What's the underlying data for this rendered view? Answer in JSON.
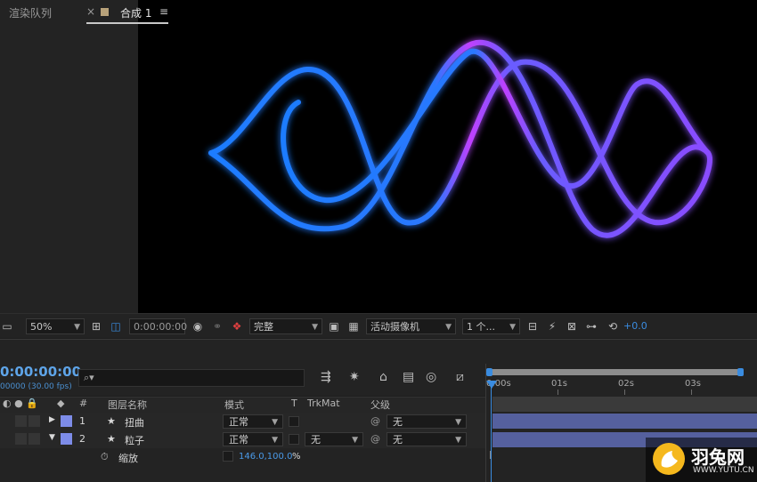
{
  "viewer_toolbar": {
    "zoom": "50%",
    "timecode": "0:00:00:00",
    "resolution": "完整",
    "camera": "活动摄像机",
    "views": "1 个...",
    "exposure": "+0.0"
  },
  "tabs": {
    "render_queue": "渲染队列",
    "close": "×",
    "comp": "合成 1",
    "menu": "≡"
  },
  "timeline": {
    "timecode": "0:00:00:00",
    "fps": "00000 (30.00 fps)",
    "search_placeholder": "",
    "ruler": [
      "0:00s",
      "01s",
      "02s",
      "03s"
    ]
  },
  "layer_header": {
    "num": "#",
    "name": "图层名称",
    "mode": "模式",
    "t": "T",
    "trkmat": "TrkMat",
    "parent": "父级"
  },
  "layers": [
    {
      "num": "1",
      "name": "扭曲",
      "mode": "正常",
      "trkmat": "",
      "parent": "无"
    },
    {
      "num": "2",
      "name": "粒子",
      "mode": "正常",
      "trkmat": "无",
      "parent": "无"
    }
  ],
  "property": {
    "name": "缩放",
    "value": "146.0,100.0",
    "unit": "%"
  },
  "watermark": {
    "text": "羽兔网",
    "sub": "WWW.YUTU.CN"
  },
  "colors": {
    "accent": "#3a8ce0",
    "layer_label": "#7d8ce8",
    "layer_bar": "#55609e"
  }
}
